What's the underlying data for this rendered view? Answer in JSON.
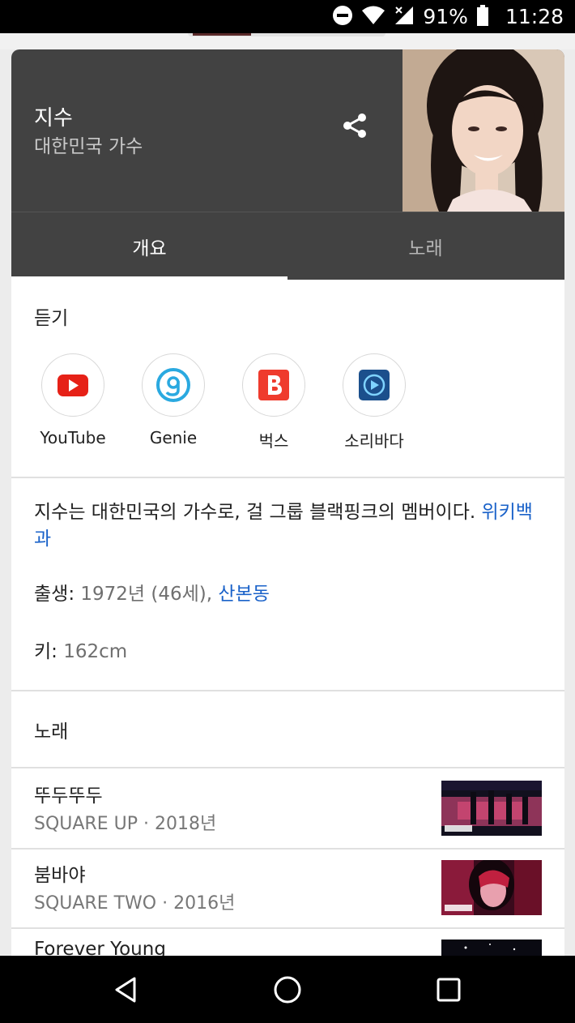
{
  "status_bar": {
    "battery": "91%",
    "time": "11:28"
  },
  "header": {
    "title": "지수",
    "subtitle": "대한민국 가수"
  },
  "tabs": [
    {
      "label": "개요",
      "active": true
    },
    {
      "label": "노래",
      "active": false
    }
  ],
  "listen": {
    "title": "듣기",
    "services": [
      {
        "label": "YouTube",
        "icon": "youtube-icon"
      },
      {
        "label": "Genie",
        "icon": "genie-icon"
      },
      {
        "label": "벅스",
        "icon": "bugs-icon"
      },
      {
        "label": "소리바다",
        "icon": "soribada-icon"
      }
    ]
  },
  "about": {
    "description": "지수는 대한민국의 가수로, 걸 그룹 블랙핑크의 멤버이다.",
    "source_link": "위키백과",
    "birth_label": "출생:",
    "birth_value": "1972년 (46세),",
    "birth_place": "산본동",
    "height_label": "키:",
    "height_value": "162cm"
  },
  "songs": {
    "title": "노래",
    "items": [
      {
        "title": "뚜두뚜두",
        "subtitle": "SQUARE UP · 2018년"
      },
      {
        "title": "붐바야",
        "subtitle": "SQUARE TWO · 2016년"
      },
      {
        "title": "Forever Young",
        "subtitle": ""
      }
    ]
  },
  "colors": {
    "header_bg": "#424242",
    "link": "#1a62c9",
    "youtube_red": "#e62117",
    "genie_blue": "#2aa9e0",
    "bugs_red": "#ef3b2d",
    "soribada_blue": "#1b4f8c"
  }
}
